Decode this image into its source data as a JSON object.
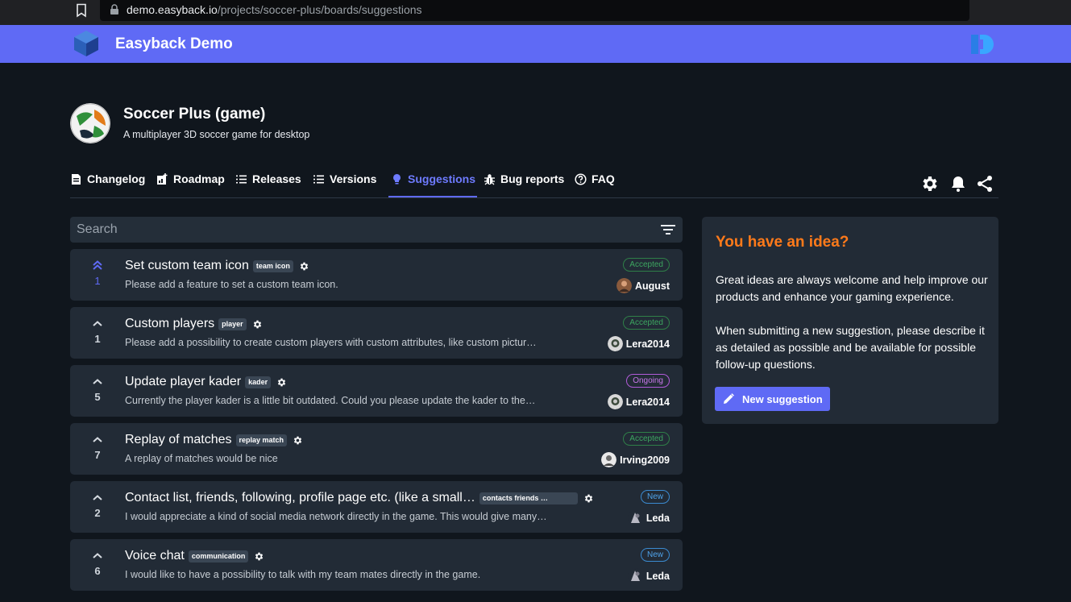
{
  "browser": {
    "url_host": "demo.easyback.io",
    "url_path": "/projects/soccer-plus/boards/suggestions"
  },
  "header": {
    "brand": "Easyback Demo"
  },
  "project": {
    "title": "Soccer Plus (game)",
    "subtitle": "A multiplayer 3D soccer game for desktop"
  },
  "nav": {
    "tabs": [
      {
        "label": "Changelog",
        "icon": "document-icon"
      },
      {
        "label": "Roadmap",
        "icon": "roadmap-icon"
      },
      {
        "label": "Releases",
        "icon": "list-icon"
      },
      {
        "label": "Versions",
        "icon": "numbered-list-icon"
      },
      {
        "label": "Suggestions",
        "icon": "lightbulb-icon",
        "active": true
      },
      {
        "label": "Bug reports",
        "icon": "bug-icon"
      },
      {
        "label": "FAQ",
        "icon": "help-circle-icon"
      }
    ]
  },
  "search": {
    "placeholder": "Search"
  },
  "suggestions": [
    {
      "votes": "1",
      "voted": true,
      "title": "Set custom team icon",
      "tag": "team icon",
      "description": "Please add a feature to set a custom team icon.",
      "status": "Accepted",
      "author": "August"
    },
    {
      "votes": "1",
      "voted": false,
      "title": "Custom players",
      "tag": "player",
      "description": "Please add a possibility to create custom players with custom attributes, like custom pictur…",
      "status": "Accepted",
      "author": "Lera2014"
    },
    {
      "votes": "5",
      "voted": false,
      "title": "Update player kader",
      "tag": "kader",
      "description": "Currently the player kader is a little bit outdated. Could you please update the kader to the…",
      "status": "Ongoing",
      "author": "Lera2014"
    },
    {
      "votes": "7",
      "voted": false,
      "title": "Replay of matches",
      "tag": "replay match",
      "description": "A replay of matches would be nice",
      "status": "Accepted",
      "author": "Irving2009"
    },
    {
      "votes": "2",
      "voted": false,
      "title": "Contact list, friends, following, profile page etc. (like a small…",
      "tag": "contacts friends …",
      "description": "I would appreciate a kind of social media network directly in the game. This would give many…",
      "status": "New",
      "author": "Leda"
    },
    {
      "votes": "6",
      "voted": false,
      "title": "Voice chat",
      "tag": "communication",
      "description": "I would like to have a possibility to talk with my team mates directly in the game.",
      "status": "New",
      "author": "Leda"
    }
  ],
  "idea_panel": {
    "title": "You have an idea?",
    "paragraph1": "Great ideas are always welcome and help improve our products and enhance your gaming experience.",
    "paragraph2": "When submitting a new suggestion, please describe it as detailed as possible and be available for possible follow-up questions.",
    "button_label": "New suggestion"
  },
  "colors": {
    "accent": "#5f6af5",
    "idea_title": "#ff7a1a",
    "accepted": "#3da660",
    "ongoing": "#c777e9",
    "new": "#4fa3ea"
  }
}
